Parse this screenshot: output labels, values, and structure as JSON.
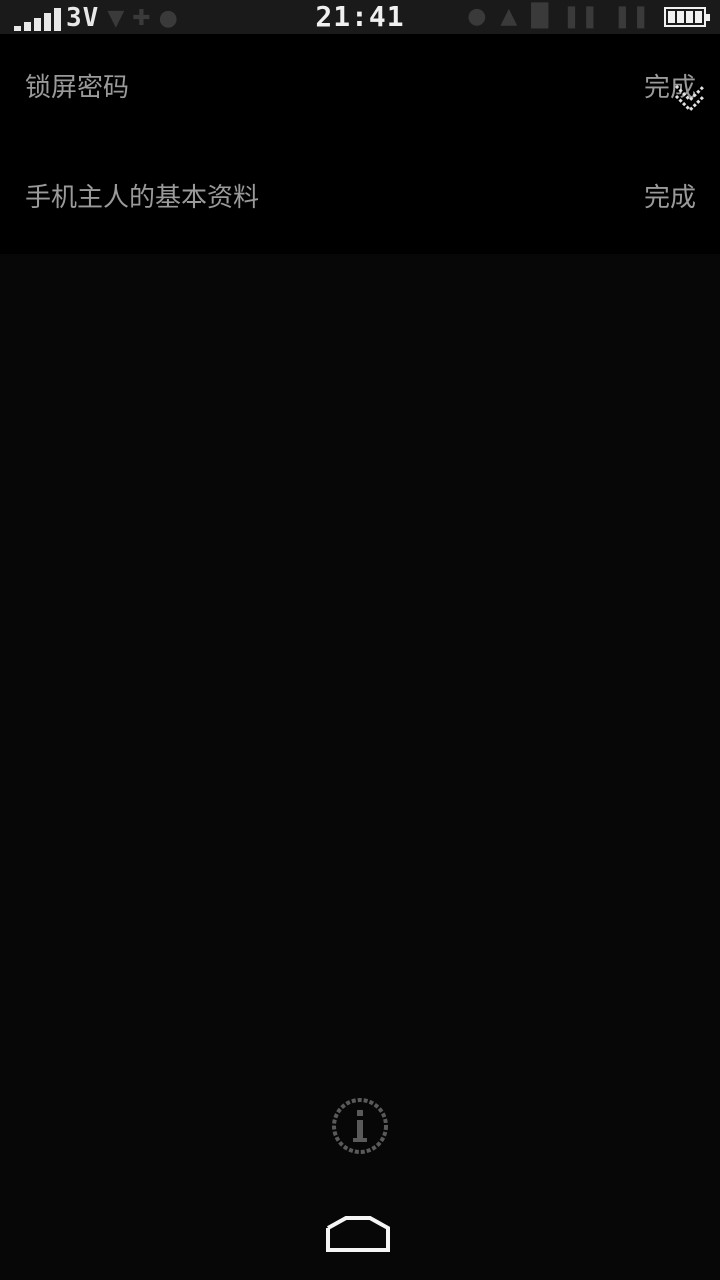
{
  "status_bar": {
    "network_type": "3V",
    "time": "21:41",
    "battery_level": 1.0,
    "signal_level": 5
  },
  "list": {
    "items": [
      {
        "label": "锁屏密码",
        "status": "完成"
      },
      {
        "label": "手机主人的基本资料",
        "status": "完成"
      }
    ]
  },
  "icons": {
    "collapse": "chevron-double-down-icon",
    "info": "info-icon",
    "home": "home-icon"
  },
  "colors": {
    "background": "#070707",
    "list_background": "#000000",
    "text": "#9a9a9a",
    "status_bar": "#1a1a1a"
  }
}
